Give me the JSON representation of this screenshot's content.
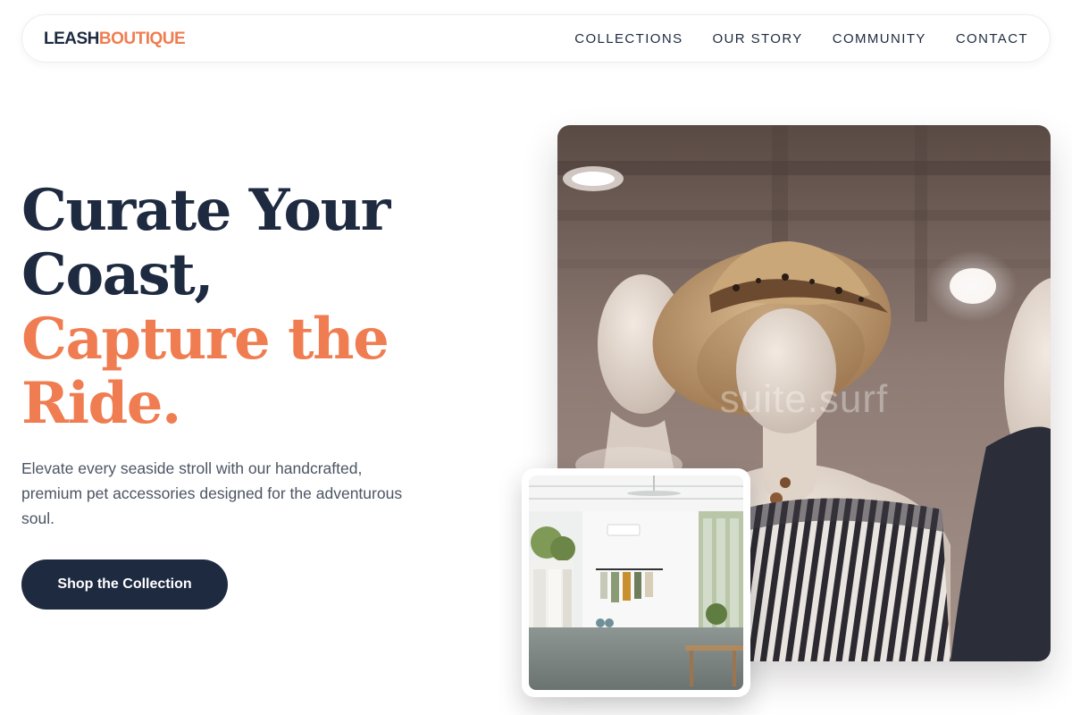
{
  "brand": {
    "logo_part1": "LEASH",
    "logo_part2": "BOUTIQUE",
    "colors": {
      "navy": "#1e2a40",
      "coral": "#f07d51"
    }
  },
  "nav": {
    "items": [
      {
        "label": "COLLECTIONS"
      },
      {
        "label": "OUR STORY"
      },
      {
        "label": "COMMUNITY"
      },
      {
        "label": "CONTACT"
      }
    ]
  },
  "hero": {
    "headline_line1": "Curate Your",
    "headline_line2": "Coast,",
    "headline_line3": "Capture the",
    "headline_line4": "Ride.",
    "subtext": "Elevate every seaside stroll with our handcrafted, premium pet accessories designed for the adventurous soul.",
    "cta_label": "Shop the Collection"
  },
  "images": {
    "main_watermark": "suite.surf",
    "main_subject": "mannequins wearing straw hat and striped top",
    "inset_subject": "bright boutique interior with clothing racks"
  }
}
